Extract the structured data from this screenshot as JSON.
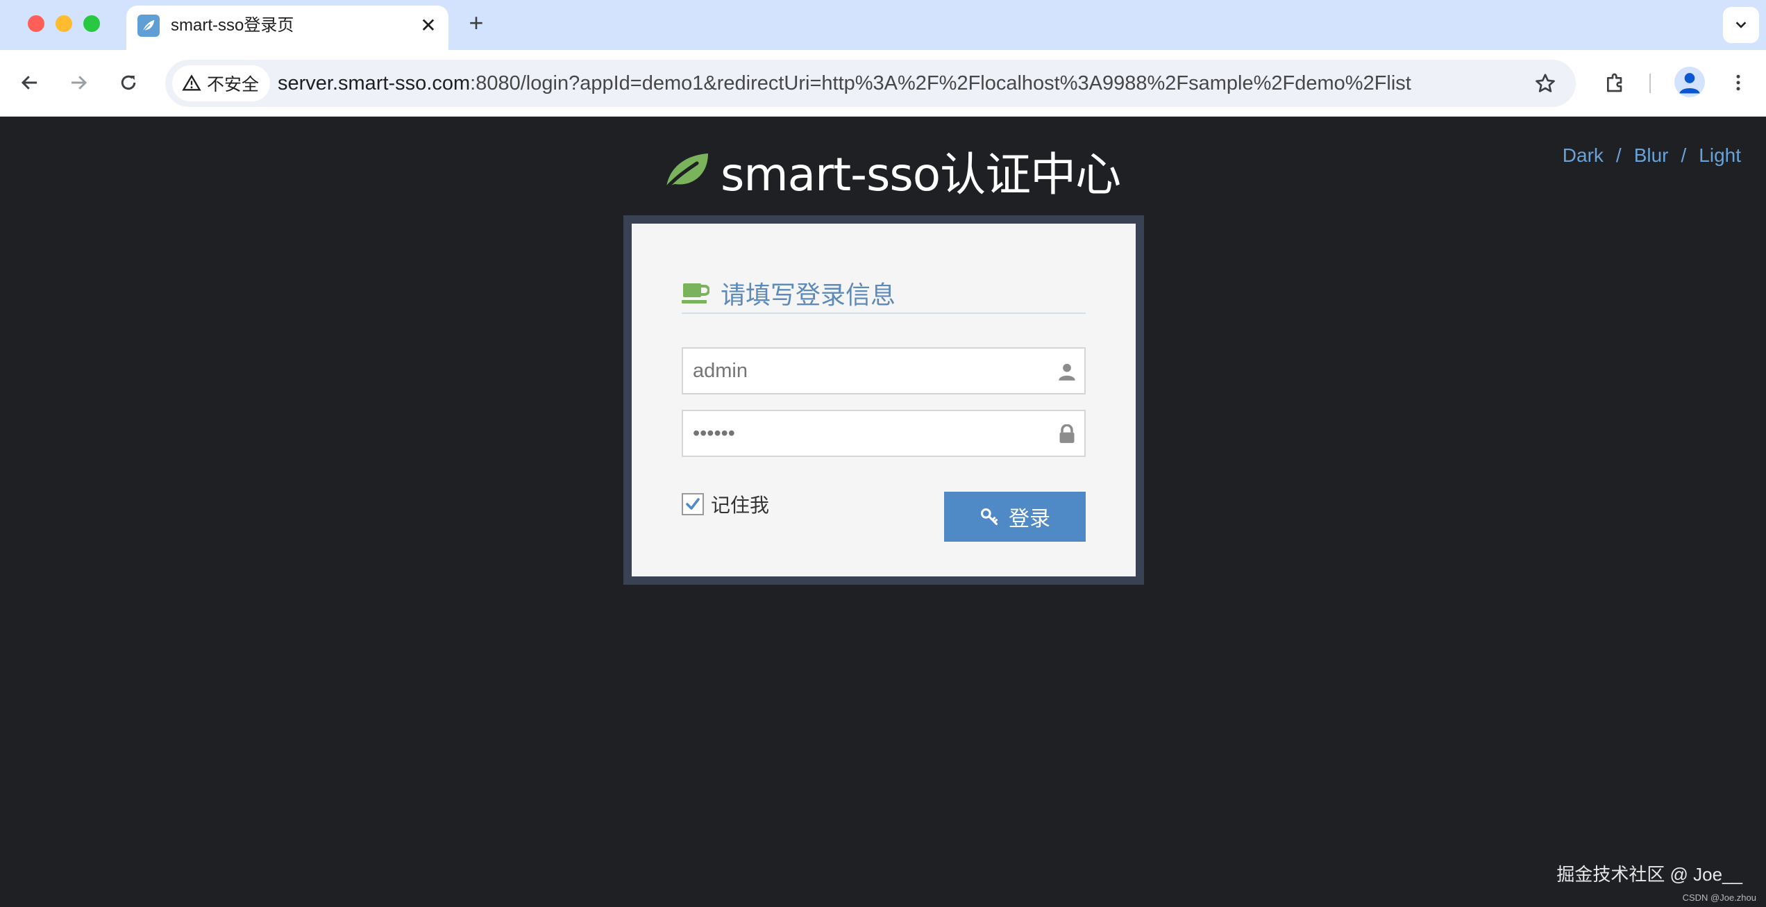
{
  "browser": {
    "tab": {
      "title": "smart-sso登录页",
      "close_glyph": "✕"
    },
    "new_tab_glyph": "+",
    "security_label": "不安全",
    "url_host": "server.smart-sso.com",
    "url_rest": ":8080/login?appId=demo1&redirectUri=http%3A%2F%2Flocalhost%3A9988%2Fsample%2Fdemo%2Flist"
  },
  "theme_switch": {
    "dark": "Dark",
    "blur": "Blur",
    "light": "Light",
    "separator": "/"
  },
  "header": {
    "title": "smart-sso认证中心"
  },
  "login": {
    "heading": "请填写登录信息",
    "username_value": "admin",
    "password_value": "123456",
    "remember_label": "记住我",
    "remember_checked": true,
    "submit_label": "登录"
  },
  "watermark": {
    "main": "掘金技术社区 @ Joe__",
    "small": "CSDN @Joe.zhou"
  },
  "colors": {
    "page_background": "#1e2024",
    "accent_blue": "#4f89c6",
    "leaf_green": "#7bb35c",
    "link_blue": "#6aa2d6"
  },
  "icons": [
    "leaf-icon",
    "coffee-icon",
    "user-icon",
    "lock-icon",
    "key-icon",
    "warning-icon",
    "star-icon",
    "extensions-icon",
    "profile-icon",
    "more-icon"
  ]
}
